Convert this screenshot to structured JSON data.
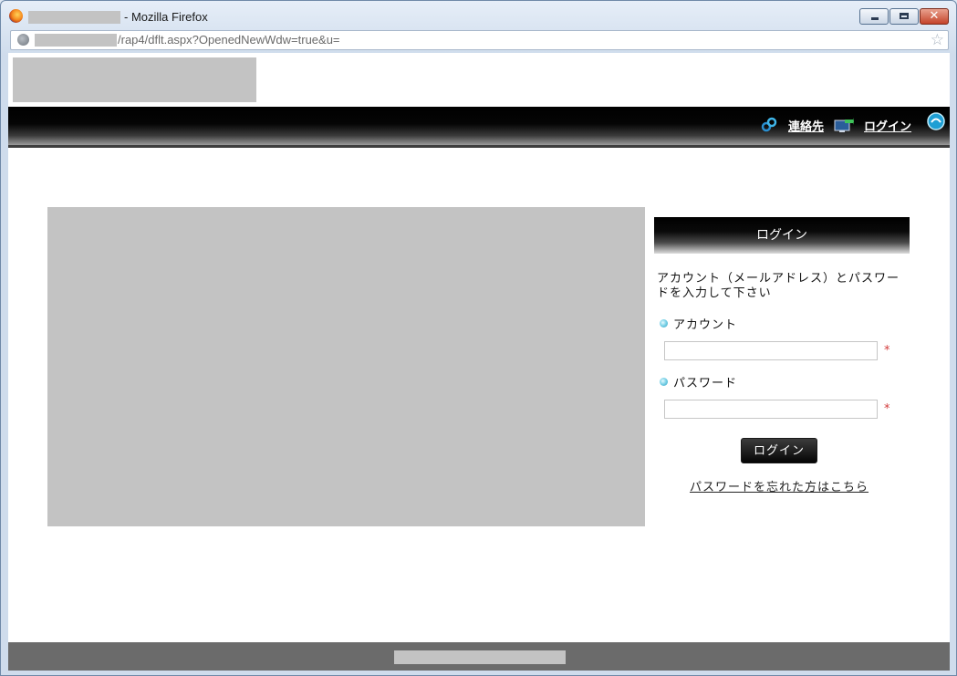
{
  "window": {
    "title": "- Mozilla Firefox",
    "close_glyph": "✕"
  },
  "address_bar": {
    "url": "/rap4/dflt.aspx?OpenedNewWdw=true&u="
  },
  "nav": {
    "contact_label": "連絡先",
    "login_label": "ログイン"
  },
  "login": {
    "header": "ログイン",
    "description": "アカウント（メールアドレス）とパスワードを入力して下さい",
    "account_label": "アカウント",
    "password_label": "パスワード",
    "required_mark": "*",
    "button_label": "ログイン",
    "forgot_link": "パスワードを忘れた方はこちら"
  },
  "icons": {
    "browser": "firefox-icon",
    "site": "globe-icon",
    "bookmark": "star-icon",
    "contact": "contact-icon",
    "login": "monitor-icon",
    "nav_extra": "globe-nav-icon",
    "field_bullet": "bullet-icon"
  },
  "colors": {
    "navbar": "#000000",
    "footer": "#6b6b6b",
    "required": "#d23b3b",
    "accent_icon": "#2ea3c4"
  }
}
